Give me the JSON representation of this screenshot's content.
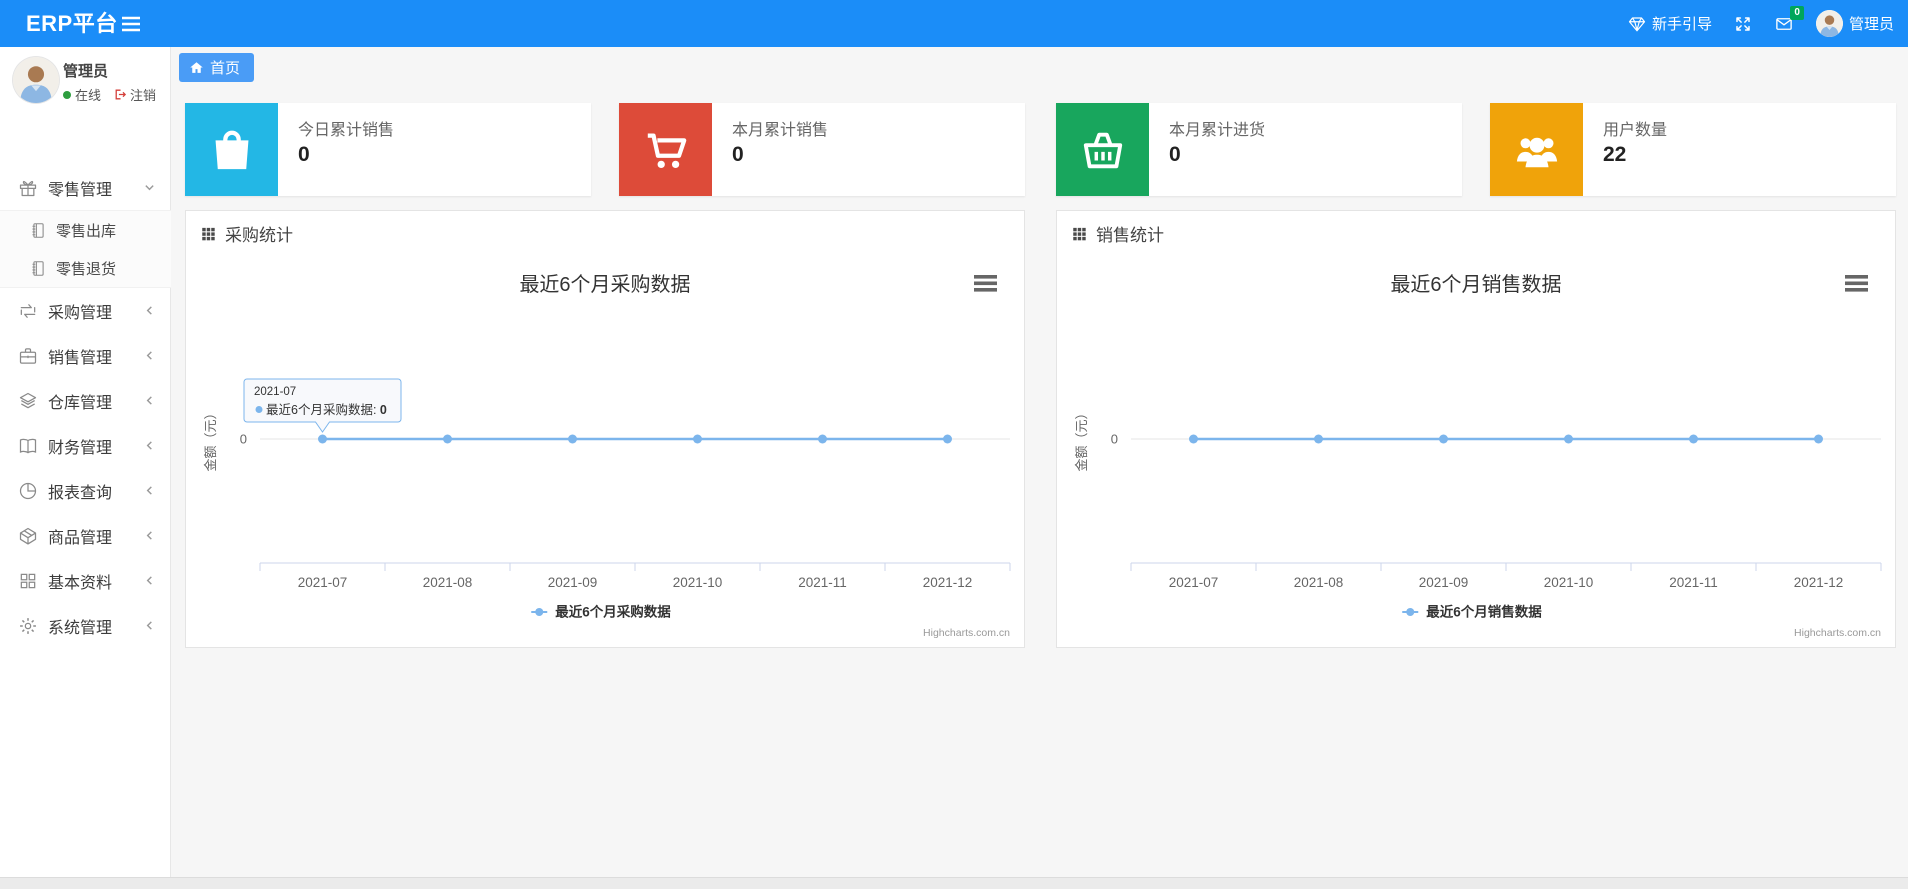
{
  "navbar": {
    "brand": "ERP平台",
    "guide_label": "新手引导",
    "mail_badge": "0",
    "username": "管理员"
  },
  "sidebar": {
    "user": {
      "name": "管理员",
      "status": "在线",
      "logout": "注销"
    },
    "menu": [
      {
        "label": "零售管理",
        "icon": "gift-icon",
        "state": "expanded",
        "children": [
          {
            "label": "零售出库",
            "icon": "journal-icon"
          },
          {
            "label": "零售退货",
            "icon": "journal-icon"
          }
        ]
      },
      {
        "label": "采购管理",
        "icon": "repeat-icon",
        "state": "collapsed"
      },
      {
        "label": "销售管理",
        "icon": "briefcase-icon",
        "state": "collapsed"
      },
      {
        "label": "仓库管理",
        "icon": "layers-icon",
        "state": "collapsed"
      },
      {
        "label": "财务管理",
        "icon": "open-book-icon",
        "state": "collapsed"
      },
      {
        "label": "报表查询",
        "icon": "pie-chart-icon",
        "state": "collapsed"
      },
      {
        "label": "商品管理",
        "icon": "box-icon",
        "state": "collapsed"
      },
      {
        "label": "基本资料",
        "icon": "grid-icon",
        "state": "collapsed"
      },
      {
        "label": "系统管理",
        "icon": "gear-icon",
        "state": "collapsed"
      }
    ]
  },
  "tabs": [
    {
      "label": "首页",
      "active": true
    }
  ],
  "stat_cards": [
    {
      "label": "今日累计销售",
      "value": "0",
      "color": "#23b7e5",
      "icon": "shopping-bag-icon"
    },
    {
      "label": "本月累计销售",
      "value": "0",
      "color": "#dd4b39",
      "icon": "cart-icon"
    },
    {
      "label": "本月累计进货",
      "value": "0",
      "color": "#18a65d",
      "icon": "basket-icon"
    },
    {
      "label": "用户数量",
      "value": "22",
      "color": "#f0a30a",
      "icon": "users-icon"
    }
  ],
  "panels": [
    {
      "title": "采购统计"
    },
    {
      "title": "销售统计"
    }
  ],
  "chart_data": [
    {
      "type": "line",
      "title": "最近6个月采购数据",
      "categories": [
        "2021-07",
        "2021-08",
        "2021-09",
        "2021-10",
        "2021-11",
        "2021-12"
      ],
      "series": [
        {
          "name": "最近6个月采购数据",
          "values": [
            0,
            0,
            0,
            0,
            0,
            0
          ]
        }
      ],
      "ylabel": "金额（元）",
      "ytick_label": "0",
      "ylim": [
        0,
        1
      ],
      "grid": true,
      "legend_position": "bottom",
      "line_color": "#7cb5ec",
      "credits": "Highcharts.com.cn",
      "tooltip": {
        "header": "2021-07",
        "series": "最近6个月采购数据",
        "value": "0"
      }
    },
    {
      "type": "line",
      "title": "最近6个月销售数据",
      "categories": [
        "2021-07",
        "2021-08",
        "2021-09",
        "2021-10",
        "2021-11",
        "2021-12"
      ],
      "series": [
        {
          "name": "最近6个月销售数据",
          "values": [
            0,
            0,
            0,
            0,
            0,
            0
          ]
        }
      ],
      "ylabel": "金额（元）",
      "ytick_label": "0",
      "ylim": [
        0,
        1
      ],
      "grid": true,
      "legend_position": "bottom",
      "line_color": "#7cb5ec",
      "credits": "Highcharts.com.cn",
      "tooltip": null
    }
  ]
}
